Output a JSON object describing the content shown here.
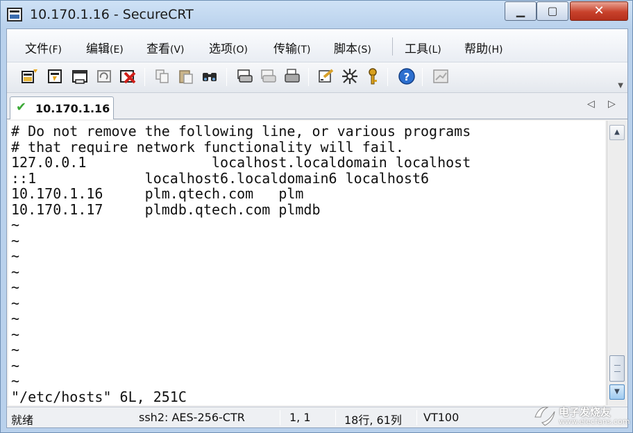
{
  "window": {
    "title": "10.170.1.16 - SecureCRT",
    "minimize_glyph": "▁",
    "maximize_glyph": "▢",
    "close_glyph": "✕"
  },
  "menu": {
    "items": [
      {
        "label": "文件",
        "accel": "(F)"
      },
      {
        "label": "编辑",
        "accel": "(E)"
      },
      {
        "label": "查看",
        "accel": "(V)"
      },
      {
        "label": "选项",
        "accel": "(O)"
      },
      {
        "label": "传输",
        "accel": "(T)"
      },
      {
        "label": "脚本",
        "accel": "(S)"
      },
      {
        "label": "工具",
        "accel": "(L)"
      },
      {
        "label": "帮助",
        "accel": "(H)"
      }
    ]
  },
  "toolbar": {
    "icons": [
      "connect-icon",
      "quick-connect-icon",
      "connect-in-tab-icon",
      "reconnect-icon",
      "disconnect-icon",
      "copy-icon",
      "paste-icon",
      "find-icon",
      "print-setup-icon",
      "print-selection-icon",
      "print-icon",
      "session-options-icon",
      "keymap-editor-icon",
      "key-icon",
      "help-icon",
      "sftp-icon"
    ]
  },
  "tabs": [
    {
      "label": "10.170.1.16",
      "status": "connected",
      "active": true
    }
  ],
  "tab_nav": {
    "prev": "◁",
    "next": "▷"
  },
  "terminal": {
    "lines": [
      "# Do not remove the following line, or various programs",
      "# that require network functionality will fail.",
      "127.0.0.1               localhost.localdomain localhost",
      "::1             localhost6.localdomain6 localhost6",
      "10.170.1.16     plm.qtech.com   plm",
      "10.170.1.17     plmdb.qtech.com plmdb",
      "~",
      "~",
      "~",
      "~",
      "~",
      "~",
      "~",
      "~",
      "~",
      "~",
      "~",
      "\"/etc/hosts\" 6L, 251C"
    ]
  },
  "scrollbar": {
    "up": "▲",
    "down": "▼"
  },
  "statusbar": {
    "ready": "就绪",
    "cipher": "ssh2: AES-256-CTR",
    "cursor": "1,  1",
    "size": "18行, 61列",
    "emulation": "VT100"
  },
  "watermark": {
    "text": "电子发烧友",
    "url": "www.elecfans.com"
  },
  "colors": {
    "window_frame": "#b9d1ec",
    "close_button": "#c8412b",
    "terminal_bg": "#ffffff",
    "connected_check": "#3aa835"
  }
}
